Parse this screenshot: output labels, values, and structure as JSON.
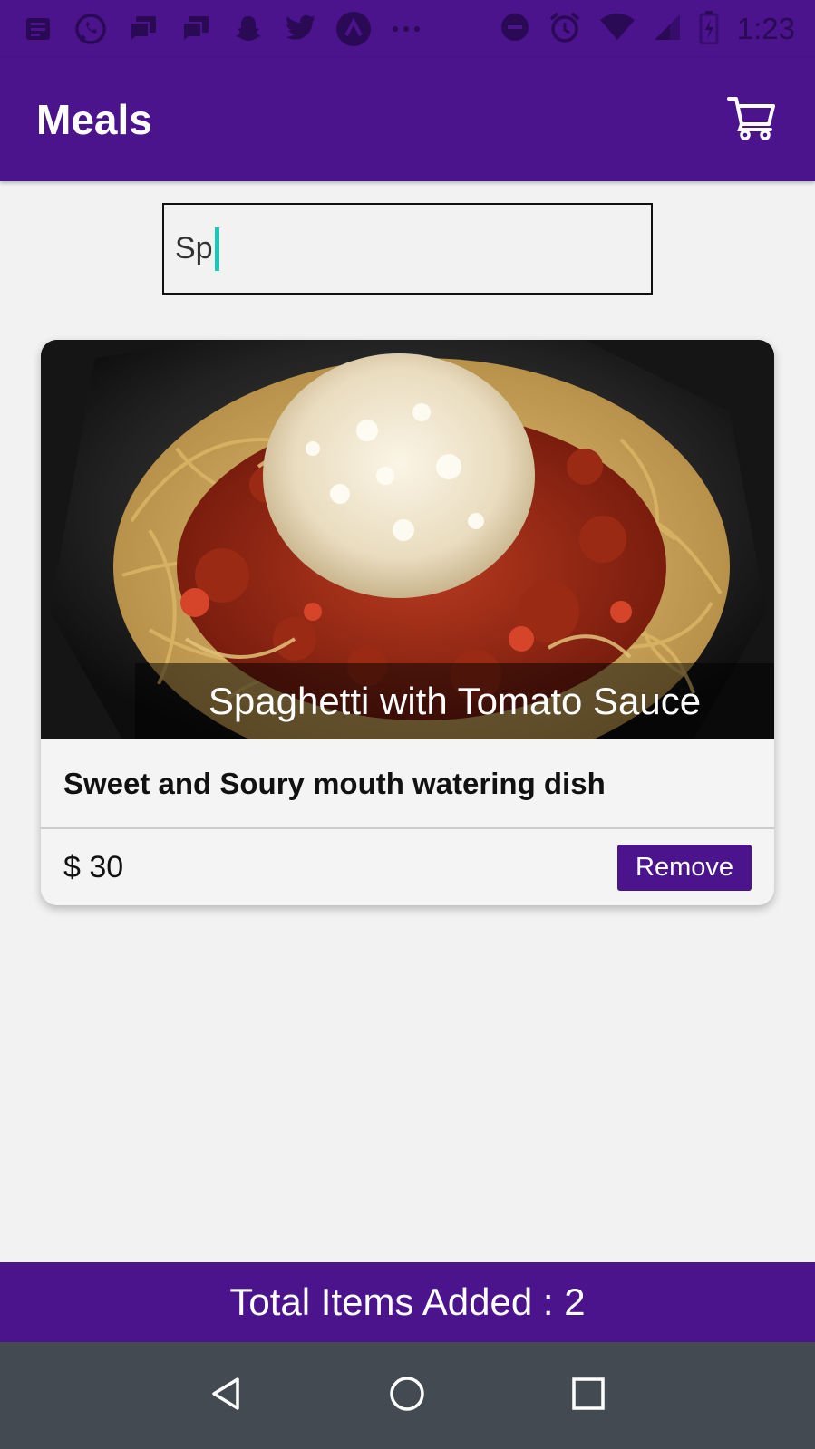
{
  "status_bar": {
    "time": "1:23",
    "icons": [
      "news-icon",
      "whatsapp-icon",
      "messages-icon",
      "messages-icon",
      "snapchat-icon",
      "twitter-icon",
      "app-icon",
      "more-dots-icon",
      "do-not-disturb-icon",
      "alarm-icon",
      "wifi-icon",
      "signal-icon",
      "battery-icon"
    ]
  },
  "app_bar": {
    "title": "Meals",
    "cart_icon": "cart-icon"
  },
  "search": {
    "value": "Sp"
  },
  "meal_card": {
    "title": "Spaghetti with Tomato Sauce",
    "description": "Sweet and Soury mouth watering dish",
    "price": "$ 30",
    "remove_label": "Remove"
  },
  "footer": {
    "total_text": "Total Items Added : 2"
  },
  "nav": {
    "back_icon": "back-icon",
    "home_icon": "home-icon",
    "recents_icon": "recents-icon"
  },
  "colors": {
    "primary": "#4b138c",
    "accent_caret": "#19c9b5",
    "nav_bar": "#434a52"
  }
}
